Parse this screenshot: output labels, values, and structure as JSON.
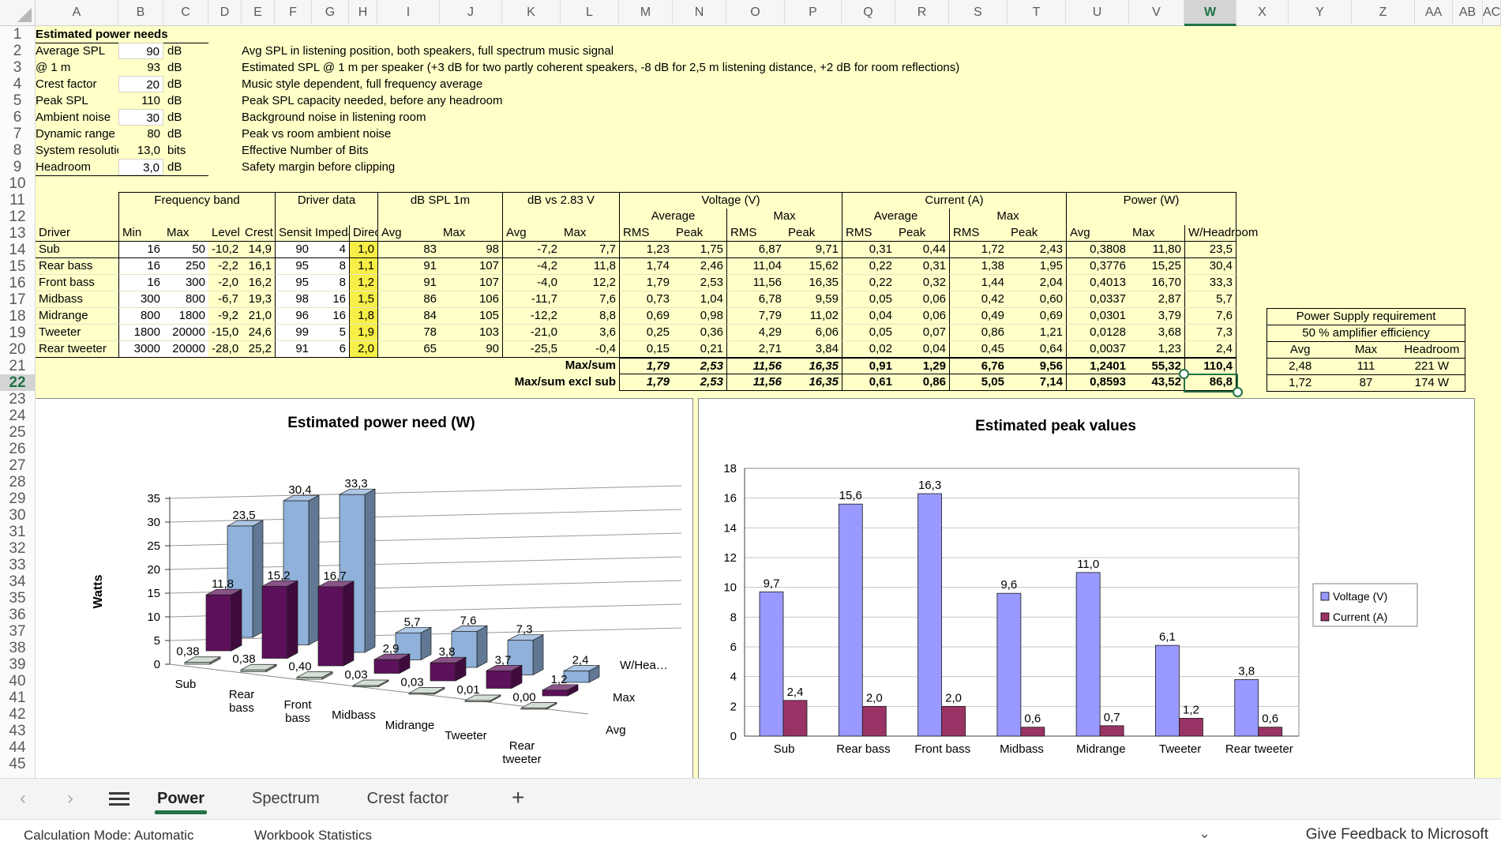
{
  "sheet": {
    "column_letters": [
      "A",
      "B",
      "C",
      "D",
      "E",
      "F",
      "G",
      "H",
      "I",
      "J",
      "K",
      "L",
      "M",
      "N",
      "O",
      "P",
      "Q",
      "R",
      "S",
      "T",
      "U",
      "V",
      "W",
      "X",
      "Y",
      "Z",
      "AA",
      "AB",
      "AC"
    ],
    "selected_column": "W",
    "visible_rows": 45,
    "selected_row": 22
  },
  "info_panel": {
    "title": "Estimated power needs",
    "rows": [
      {
        "label": "Average SPL",
        "value": "90",
        "unit": "dB",
        "editable": true,
        "desc": "Avg SPL in listening position, both speakers, full spectrum music signal"
      },
      {
        "label": "@ 1 m",
        "value": "93",
        "unit": "dB",
        "editable": false,
        "desc": "Estimated SPL @ 1 m per speaker (+3 dB for two partly coherent speakers, -8 dB for 2,5 m listening distance, +2 dB for room reflections)"
      },
      {
        "label": "Crest factor",
        "value": "20",
        "unit": "dB",
        "editable": true,
        "desc": "Music style dependent, full frequency average"
      },
      {
        "label": "Peak SPL",
        "value": "110",
        "unit": "dB",
        "editable": false,
        "desc": "Peak SPL capacity needed, before any headroom"
      },
      {
        "label": "Ambient noise",
        "value": "30",
        "unit": "dB",
        "editable": true,
        "desc": "Background noise in listening room"
      },
      {
        "label": "Dynamic range",
        "value": "80",
        "unit": "dB",
        "editable": false,
        "desc": "Peak vs room ambient noise"
      },
      {
        "label": "System resolutic",
        "value": "13,0",
        "unit": "bits",
        "editable": false,
        "desc": "Effective Number of Bits"
      },
      {
        "label": "Headroom",
        "value": "3,0",
        "unit": "dB",
        "editable": true,
        "desc": "Safety margin before clipping"
      }
    ]
  },
  "main_table": {
    "groups": [
      "Frequency band",
      "Driver data",
      "dB SPL 1m",
      "dB vs 2.83 V",
      "Voltage (V)",
      "Current (A)",
      "Power (W)"
    ],
    "subheaders": {
      "average": "Average",
      "max": "Max"
    },
    "columns": [
      "Driver",
      "Min",
      "Max",
      "Level",
      "Crest",
      "Sensiti",
      "Impeda",
      "Directiv",
      "Avg",
      "Max",
      "Avg",
      "Max",
      "RMS",
      "Peak",
      "RMS",
      "Peak",
      "RMS",
      "Peak",
      "RMS",
      "Peak",
      "Avg",
      "Max",
      "W/Headroom"
    ],
    "rows": [
      {
        "driver": "Sub",
        "cells": [
          "16",
          "50",
          "-10,2",
          "14,9",
          "90",
          "4",
          "1,0",
          "83",
          "98",
          "-7,2",
          "7,7",
          "1,23",
          "1,75",
          "6,87",
          "9,71",
          "0,31",
          "0,44",
          "1,72",
          "2,43",
          "0,3808",
          "11,80",
          "23,5"
        ]
      },
      {
        "driver": "Rear bass",
        "cells": [
          "16",
          "250",
          "-2,2",
          "16,1",
          "95",
          "8",
          "1,1",
          "91",
          "107",
          "-4,2",
          "11,8",
          "1,74",
          "2,46",
          "11,04",
          "15,62",
          "0,22",
          "0,31",
          "1,38",
          "1,95",
          "0,3776",
          "15,25",
          "30,4"
        ]
      },
      {
        "driver": "Front bass",
        "cells": [
          "16",
          "300",
          "-2,0",
          "16,2",
          "95",
          "8",
          "1,2",
          "91",
          "107",
          "-4,0",
          "12,2",
          "1,79",
          "2,53",
          "11,56",
          "16,35",
          "0,22",
          "0,32",
          "1,44",
          "2,04",
          "0,4013",
          "16,70",
          "33,3"
        ]
      },
      {
        "driver": "Midbass",
        "cells": [
          "300",
          "800",
          "-6,7",
          "19,3",
          "98",
          "16",
          "1,5",
          "86",
          "106",
          "-11,7",
          "7,6",
          "0,73",
          "1,04",
          "6,78",
          "9,59",
          "0,05",
          "0,06",
          "0,42",
          "0,60",
          "0,0337",
          "2,87",
          "5,7"
        ]
      },
      {
        "driver": "Midrange",
        "cells": [
          "800",
          "1800",
          "-9,2",
          "21,0",
          "96",
          "16",
          "1,8",
          "84",
          "105",
          "-12,2",
          "8,8",
          "0,69",
          "0,98",
          "7,79",
          "11,02",
          "0,04",
          "0,06",
          "0,49",
          "0,69",
          "0,0301",
          "3,79",
          "7,6"
        ]
      },
      {
        "driver": "Tweeter",
        "cells": [
          "1800",
          "20000",
          "-15,0",
          "24,6",
          "99",
          "5",
          "1,9",
          "78",
          "103",
          "-21,0",
          "3,6",
          "0,25",
          "0,36",
          "4,29",
          "6,06",
          "0,05",
          "0,07",
          "0,86",
          "1,21",
          "0,0128",
          "3,68",
          "7,3"
        ]
      },
      {
        "driver": "Rear tweeter",
        "cells": [
          "3000",
          "20000",
          "-28,0",
          "25,2",
          "91",
          "6",
          "2,0",
          "65",
          "90",
          "-25,5",
          "-0,4",
          "0,15",
          "0,21",
          "2,71",
          "3,84",
          "0,02",
          "0,04",
          "0,45",
          "0,64",
          "0,0037",
          "1,23",
          "2,4"
        ]
      }
    ],
    "summary_rows": [
      {
        "label": "Max/sum",
        "values": [
          "1,79",
          "2,53",
          "11,56",
          "16,35",
          "0,91",
          "1,29",
          "6,76",
          "9,56",
          "1,2401",
          "55,32",
          "110,4"
        ]
      },
      {
        "label": "Max/sum excl sub",
        "values": [
          "1,79",
          "2,53",
          "11,56",
          "16,35",
          "0,61",
          "0,86",
          "5,05",
          "7,14",
          "0,8593",
          "43,52",
          "86,8"
        ]
      }
    ]
  },
  "power_supply_box": {
    "title": "Power Supply requirement",
    "subtitle": "50 % amplifier efficiency",
    "headers": [
      "Avg",
      "Max",
      "Headroom"
    ],
    "rows": [
      [
        "2,48",
        "111",
        "221 W"
      ],
      [
        "1,72",
        "87",
        "174 W"
      ]
    ]
  },
  "chart_data": [
    {
      "type": "bar",
      "projection": "3d",
      "title": "Estimated power need (W)",
      "xlabel": "",
      "ylabel": "Watts",
      "ylim": [
        0,
        35
      ],
      "ytick_step": 5,
      "grid": true,
      "legend_position": "depth-axis-right",
      "categories": [
        "Sub",
        "Rear bass",
        "Front bass",
        "Midbass",
        "Midrange",
        "Tweeter",
        "Rear tweeter"
      ],
      "series": [
        {
          "name": "Avg",
          "display": "Avg",
          "color": "#C2D3C4",
          "values": [
            0.38,
            0.38,
            0.4,
            0.03,
            0.03,
            0.01,
            0.0
          ],
          "labels": [
            "0,38",
            "0,38",
            "0,40",
            "0,03",
            "0,03",
            "0,01",
            "0,00"
          ]
        },
        {
          "name": "Max",
          "display": "Max",
          "color": "#5D115A",
          "values": [
            11.8,
            15.2,
            16.7,
            2.9,
            3.8,
            3.7,
            1.2
          ],
          "labels": [
            "11,8",
            "15,2",
            "16,7",
            "2,9",
            "3,8",
            "3,7",
            "1,2"
          ]
        },
        {
          "name": "W/Headroom",
          "display": "W/Hea…",
          "color": "#8FB1DA",
          "values": [
            23.5,
            30.4,
            33.3,
            5.7,
            7.6,
            7.3,
            2.4
          ],
          "labels": [
            "23,5",
            "30,4",
            "33,3",
            "5,7",
            "7,6",
            "7,3",
            "2,4"
          ]
        }
      ]
    },
    {
      "type": "bar",
      "title": "Estimated peak values",
      "xlabel": "",
      "ylabel": "",
      "ylim": [
        0,
        18
      ],
      "ytick_step": 2,
      "grid": true,
      "legend_position": "right",
      "categories": [
        "Sub",
        "Rear bass",
        "Front bass",
        "Midbass",
        "Midrange",
        "Tweeter",
        "Rear tweeter"
      ],
      "series": [
        {
          "name": "Voltage (V)",
          "color": "#9999FF",
          "values": [
            9.7,
            15.6,
            16.3,
            9.6,
            11.0,
            6.1,
            3.8
          ],
          "labels": [
            "9,7",
            "15,6",
            "16,3",
            "9,6",
            "11,0",
            "6,1",
            "3,8"
          ]
        },
        {
          "name": "Current (A)",
          "color": "#993366",
          "values": [
            2.4,
            2.0,
            2.0,
            0.6,
            0.7,
            1.2,
            0.6
          ],
          "labels": [
            "2,4",
            "2,0",
            "2,0",
            "0,6",
            "0,7",
            "1,2",
            "0,6"
          ]
        }
      ]
    }
  ],
  "sheet_tabs": {
    "prev_icon": "‹",
    "next_icon": "›",
    "sheets": [
      {
        "label": "Power",
        "active": true
      },
      {
        "label": "Spectrum",
        "active": false
      },
      {
        "label": "Crest factor",
        "active": false
      }
    ],
    "add_label": "+"
  },
  "status_bar": {
    "items": [
      "Calculation Mode: Automatic",
      "Workbook Statistics"
    ],
    "feedback": "Give Feedback to Microsoft"
  },
  "colors": {
    "accent_green": "#217346",
    "sheet_bg": "#FFFFC8",
    "highlight_yellow": "#F7EF47",
    "voltage": "#9999FF",
    "current": "#993366"
  }
}
